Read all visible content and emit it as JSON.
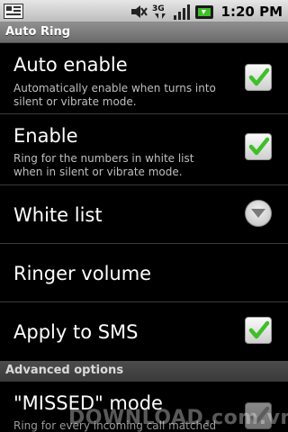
{
  "status_bar": {
    "time": "1:20 PM",
    "network_label": "3G",
    "icons": [
      "notification-icon",
      "mute-icon",
      "3g-icon",
      "signal-icon",
      "battery-icon"
    ]
  },
  "app": {
    "title": "Auto Ring"
  },
  "preferences": [
    {
      "title": "Auto enable",
      "summary_lines": [
        "Automatically enable when turns into",
        "silent or vibrate mode."
      ],
      "widget": "checkbox",
      "checked": true
    },
    {
      "title": "Enable",
      "summary_lines": [
        "Ring for the numbers in white list",
        "when in silent or vibrate mode."
      ],
      "widget": "checkbox",
      "checked": true
    },
    {
      "title": "White list",
      "widget": "dropdown-arrow"
    },
    {
      "title": "Ringer volume"
    },
    {
      "title": "Apply to SMS",
      "widget": "checkbox",
      "checked": true
    }
  ],
  "advanced": {
    "category_label": "Advanced options",
    "missed_mode": {
      "title": "\"MISSED\" mode",
      "summary": "Ring for every incoming call matched",
      "widget": "checkbox",
      "checked": true,
      "enabled": false
    }
  },
  "watermark": "DOWNLOAD.com.vn",
  "colors": {
    "checkmark_green": "#3fbf2a",
    "background": "#000000",
    "summary_text": "#bfbfbf"
  }
}
